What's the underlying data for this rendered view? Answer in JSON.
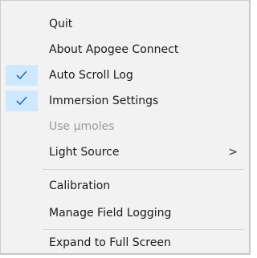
{
  "menu": {
    "items": [
      {
        "label": "Quit",
        "checked": false,
        "disabled": false
      },
      {
        "label": "About Apogee Connect",
        "checked": false,
        "disabled": false
      },
      {
        "label": "Auto Scroll Log",
        "checked": true,
        "disabled": false
      },
      {
        "label": "Immersion Settings",
        "checked": true,
        "disabled": false
      },
      {
        "label": "Use µmoles",
        "checked": false,
        "disabled": true
      },
      {
        "label": "Light Source",
        "checked": false,
        "disabled": false,
        "submenu_arrow": ">"
      },
      {
        "label": "Calibration",
        "checked": false,
        "disabled": false
      },
      {
        "label": "Manage Field Logging",
        "checked": false,
        "disabled": false
      },
      {
        "label": "Expand to Full Screen",
        "checked": false,
        "disabled": false
      }
    ],
    "check_icon": "checkmark-icon",
    "submenu_icon": "chevron-right-icon",
    "colors": {
      "background": "#f2f2f2",
      "check_highlight": "#cde8ff",
      "check_mark": "#2b6cb0",
      "disabled_text": "#9a9a9a"
    }
  }
}
